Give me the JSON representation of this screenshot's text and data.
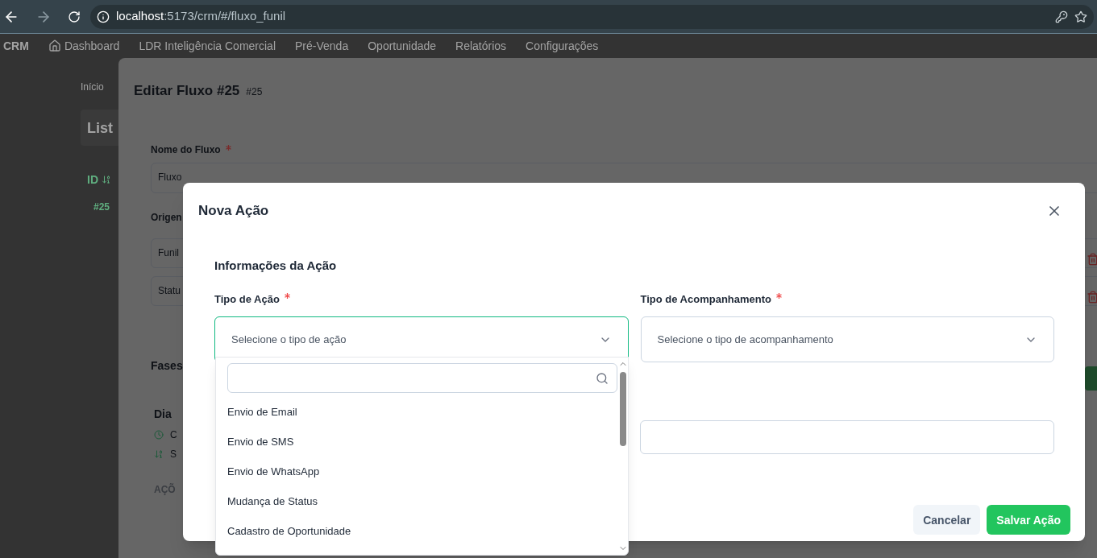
{
  "browser": {
    "url_host": "localhost",
    "url_path": ":5173/crm/#/fluxo_funil"
  },
  "nav": {
    "brand": "CRM",
    "items": [
      "Dashboard",
      "LDR Inteligência Comercial",
      "Pré-Venda",
      "Oportunidade",
      "Relatórios",
      "Configurações"
    ]
  },
  "background": {
    "breadcrumb": "Início",
    "list_title": "List",
    "id_column": "ID",
    "row_id": "#25"
  },
  "edit_modal": {
    "title": "Editar Fluxo #25",
    "badge": "#25",
    "name_label": "Nome do Fluxo",
    "name_required": true,
    "name_value": "Fluxo",
    "origin_label": "Origen",
    "origin_fields": [
      "Funil",
      "Statu"
    ],
    "phases_label": "Fases",
    "phase_title": "Dia",
    "phase_lines": [
      "C",
      "S"
    ],
    "actions_label": "AÇÕ"
  },
  "action_modal": {
    "title": "Nova Ação",
    "section": "Informações da Ação",
    "fields": [
      {
        "label": "Tipo de Ação",
        "required": true,
        "placeholder": "Selecione o tipo de ação",
        "open": true
      },
      {
        "label": "Tipo de Acompanhamento",
        "required": true,
        "placeholder": "Selecione o tipo de acompanhamento",
        "open": false
      }
    ],
    "dropdown": {
      "options": [
        "Envio de Email",
        "Envio de SMS",
        "Envio de WhatsApp",
        "Mudança de Status",
        "Cadastro de Oportunidade"
      ]
    },
    "buttons": [
      {
        "label": "Cancelar",
        "kind": "secondary"
      },
      {
        "label": "Salvar Ação",
        "kind": "primary"
      }
    ]
  }
}
